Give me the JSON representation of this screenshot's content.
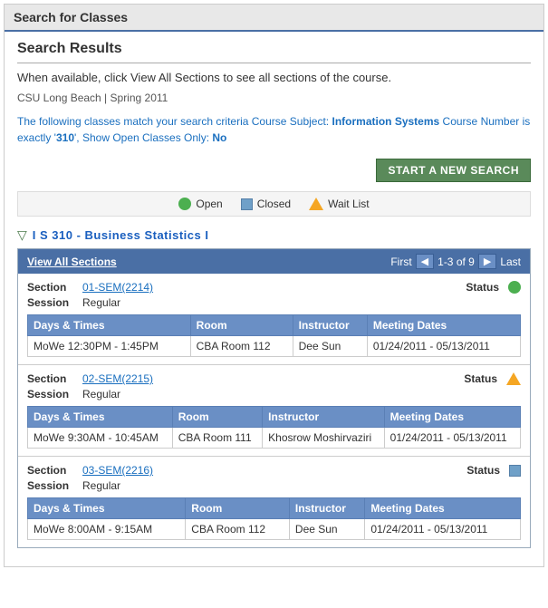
{
  "page": {
    "title": "Search for Classes",
    "heading": "Search Results",
    "description": "When available, click View All Sections to see all sections of the course.",
    "institution": "CSU Long Beach | Spring 2011",
    "criteria": {
      "prefix": "The following classes match your search criteria Course Subject:",
      "subject": "Information Systems",
      "middle": "  Course Number is exactly '",
      "number": "310",
      "suffix": "',  Show Open Classes Only:",
      "openOnly": "No"
    },
    "new_search_label": "START A NEW SEARCH"
  },
  "legend": {
    "open": "Open",
    "closed": "Closed",
    "waitlist": "Wait List"
  },
  "course": {
    "code": "I S 310 - Business Statistics I",
    "table_header": {
      "view_all": "View All Sections",
      "pagination": "First",
      "range": "1-3 of 9",
      "last": "Last"
    },
    "sections": [
      {
        "id": "01-SEM(2214)",
        "status": "open",
        "session": "Regular",
        "days_times": "MoWe 12:30PM - 1:45PM",
        "room": "CBA  Room 112",
        "instructor": "Dee Sun",
        "meeting_dates": "01/24/2011 - 05/13/2011"
      },
      {
        "id": "02-SEM(2215)",
        "status": "waitlist",
        "session": "Regular",
        "days_times": "MoWe 9:30AM - 10:45AM",
        "room": "CBA  Room 111",
        "instructor": "Khosrow Moshirvaziri",
        "meeting_dates": "01/24/2011 - 05/13/2011"
      },
      {
        "id": "03-SEM(2216)",
        "status": "closed",
        "session": "Regular",
        "days_times": "MoWe 8:00AM - 9:15AM",
        "room": "CBA  Room 112",
        "instructor": "Dee Sun",
        "meeting_dates": "01/24/2011 - 05/13/2011"
      }
    ],
    "columns": {
      "days_times": "Days & Times",
      "room": "Room",
      "instructor": "Instructor",
      "meeting_dates": "Meeting Dates"
    },
    "labels": {
      "section": "Section",
      "status": "Status",
      "session": "Session"
    }
  }
}
